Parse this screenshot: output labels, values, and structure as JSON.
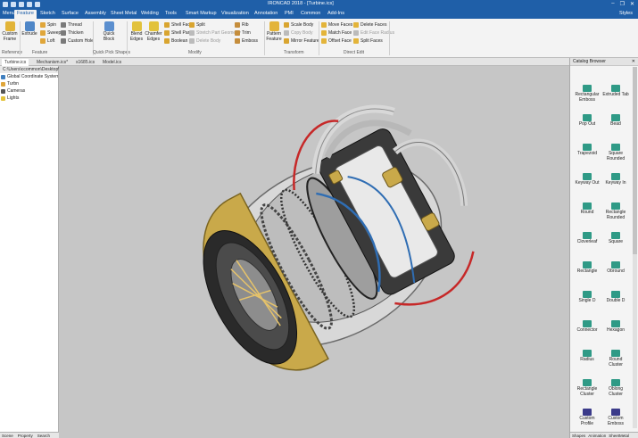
{
  "app": {
    "title": "IRONCAD 2018 - [Turbine.ics]",
    "window_controls": [
      "–",
      "❐",
      "✕"
    ]
  },
  "ribbon_tabs": [
    {
      "label": "Menu"
    },
    {
      "label": "Feature"
    },
    {
      "label": "Sketch"
    },
    {
      "label": "Surface"
    },
    {
      "label": "Assembly"
    },
    {
      "label": "Sheet Metal"
    },
    {
      "label": "Welding"
    },
    {
      "label": "Tools"
    },
    {
      "label": "Smart Markup"
    },
    {
      "label": "Visualization"
    },
    {
      "label": "Annotation"
    },
    {
      "label": "PMI"
    },
    {
      "label": "Common"
    },
    {
      "label": "Add-Ins"
    }
  ],
  "styles_label": "Styles",
  "ribbon": {
    "feature_btn": "Custom Frame",
    "extrude": "Extrude",
    "spin": "Spin",
    "sweep": "Sweep",
    "loft": "Loft",
    "thread": "Thread",
    "thicken": "Thicken",
    "custom_hole": "Custom Hole",
    "quick_block": "Quick Block",
    "blend_edges": "Blend Edges",
    "chamfer_edges": "Chamfer Edges",
    "shell_faces": "Shell Faces",
    "shell_part": "Shell Part",
    "boolean": "Boolean",
    "split": "Split",
    "stretch_part": "Stretch Part Geometry",
    "delete_body": "Delete Body",
    "rib": "Rib",
    "trim": "Trim",
    "emboss": "Emboss",
    "pattern_feature": "Pattern Feature",
    "scale_body": "Scale Body",
    "copy_body": "Copy Body",
    "mirror_feature": "Mirror Feature",
    "move_faces": "Move Faces",
    "match_face": "Match Face",
    "offset_face": "Offset Face",
    "delete_faces": "Delete Faces",
    "edit_face_radius": "Edit Face Radius",
    "split_faces": "Split Faces",
    "groups": {
      "reference": "Reference",
      "feature": "Feature",
      "quick_pick": "Quick Pick Shapes",
      "modify": "Modify",
      "transform": "Transform",
      "direct_edit": "Direct Edit"
    }
  },
  "doc_tabs": [
    {
      "label": "Turbine.ics"
    },
    {
      "label": "Mechanism.ics*"
    },
    {
      "label": "s1685.ics"
    },
    {
      "label": "Model.ics"
    }
  ],
  "tree": {
    "path": "C:\\Users\\ccommon\\Desktop\\201",
    "nodes": [
      {
        "label": "Global Coordinate System"
      },
      {
        "label": "Turbn"
      },
      {
        "label": "Cameras"
      },
      {
        "label": "Lights"
      }
    ],
    "bottom_tabs": [
      "Scene",
      "Property",
      "Search"
    ]
  },
  "catalog": {
    "title": "Catalog Browser",
    "items": [
      {
        "label": "Rectangular Emboss"
      },
      {
        "label": "Extruded Tab"
      },
      {
        "label": "Pop Out"
      },
      {
        "label": "Bead"
      },
      {
        "label": "Trapezoid"
      },
      {
        "label": "Square Rounded"
      },
      {
        "label": "Keyway Out"
      },
      {
        "label": "Keyway In"
      },
      {
        "label": "Round"
      },
      {
        "label": "Rectangle Rounded"
      },
      {
        "label": "Cloverleaf"
      },
      {
        "label": "Square"
      },
      {
        "label": "Rectangle"
      },
      {
        "label": "Obround"
      },
      {
        "label": "Single D"
      },
      {
        "label": "Double D"
      },
      {
        "label": "Connector"
      },
      {
        "label": "Hexagon"
      },
      {
        "label": "Radius"
      },
      {
        "label": "Round Cluster"
      },
      {
        "label": "Rectangle Cluster"
      },
      {
        "label": "Oblong Cluster"
      },
      {
        "label": "Custom Profile"
      },
      {
        "label": "Custom Emboss"
      }
    ],
    "bottom_tabs": [
      "Shapes",
      "Animation",
      "SheetMetal"
    ]
  },
  "colors": {
    "ribbon_blue": "#1f5fa8",
    "viewport_bg": "#c6c6c6",
    "catalog_icon": "#2f9a86",
    "model_gold": "#c9a94a",
    "model_dark": "#2a2a2a"
  }
}
